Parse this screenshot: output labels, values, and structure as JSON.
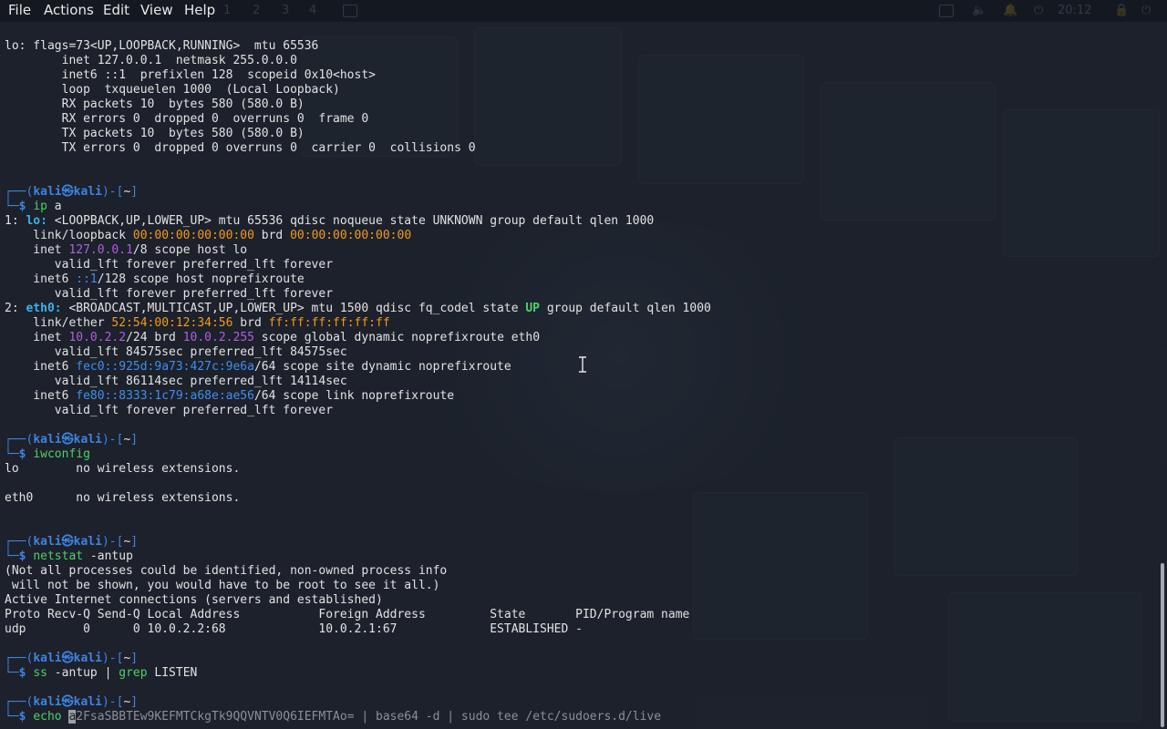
{
  "menubar": {
    "items": [
      {
        "id": "file",
        "label": "File"
      },
      {
        "id": "actions",
        "label": "Actions"
      },
      {
        "id": "edit",
        "label": "Edit"
      },
      {
        "id": "view",
        "label": "View"
      },
      {
        "id": "help",
        "label": "Help"
      }
    ],
    "workspaces": [
      "1",
      "2",
      "3",
      "4"
    ],
    "clock": "20:12"
  },
  "colors": {
    "prompt": "#3f83e0",
    "interface": "#3fb0e8",
    "mac": "#f59a1a",
    "ipv4": "#b25fdd",
    "ipv6": "#3f8ff0",
    "state_up": "#4ed36b",
    "command": "#4fcf6a"
  },
  "prompt": {
    "user": "kali",
    "at_icon": "skull-icon",
    "host": "kali",
    "dir": "~",
    "dollar": "$"
  },
  "lo_ifconfig": [
    "lo: flags=73<UP,LOOPBACK,RUNNING>  mtu 65536",
    "        inet 127.0.0.1  netmask 255.0.0.0",
    "        inet6 ::1  prefixlen 128  scopeid 0x10<host>",
    "        loop  txqueuelen 1000  (Local Loopback)",
    "        RX packets 10  bytes 580 (580.0 B)",
    "        RX errors 0  dropped 0  overruns 0  frame 0",
    "        TX packets 10  bytes 580 (580.0 B)",
    "        TX errors 0  dropped 0 overruns 0  carrier 0  collisions 0"
  ],
  "cmd_ip": {
    "command": "ip",
    "args": " a"
  },
  "ip_a": {
    "l1_num": "1: ",
    "l1_if": "lo:",
    "l1_rest": " <LOOPBACK,UP,LOWER_UP> mtu 65536 qdisc noqueue state UNKNOWN group default qlen 1000",
    "l2_pre": "    link/loopback ",
    "l2_mac": "00:00:00:00:00:00",
    "l2_mid": " brd ",
    "l2_brd": "00:00:00:00:00:00",
    "l3_pre": "    inet ",
    "l3_ip": "127.0.0.1",
    "l3_post": "/8 scope host lo",
    "l4": "       valid_lft forever preferred_lft forever",
    "l5_pre": "    inet6 ",
    "l5_ip": "::1",
    "l5_post": "/128 scope host noprefixroute",
    "l6": "       valid_lft forever preferred_lft forever",
    "l7_num": "2: ",
    "l7_if": "eth0:",
    "l7_mid": " <BROADCAST,MULTICAST,UP,LOWER_UP> mtu 1500 qdisc fq_codel state ",
    "l7_state": "UP",
    "l7_post": " group default qlen 1000",
    "l8_pre": "    link/ether ",
    "l8_mac": "52:54:00:12:34:56",
    "l8_mid": " brd ",
    "l8_brd": "ff:ff:ff:ff:ff:ff",
    "l9_pre": "    inet ",
    "l9_ip": "10.0.2.2",
    "l9_mid": "/24 brd ",
    "l9_brd": "10.0.2.255",
    "l9_post": " scope global dynamic noprefixroute eth0",
    "l10": "       valid_lft 84575sec preferred_lft 84575sec",
    "l11_pre": "    inet6 ",
    "l11_ip": "fec0::925d:9a73:427c:9e6a",
    "l11_post": "/64 scope site dynamic noprefixroute",
    "l12": "       valid_lft 86114sec preferred_lft 14114sec",
    "l13_pre": "    inet6 ",
    "l13_ip": "fe80::8333:1c79:a68e:ae56",
    "l13_post": "/64 scope link noprefixroute",
    "l14": "       valid_lft forever preferred_lft forever"
  },
  "cmd_iwconfig": {
    "command": "iwconfig"
  },
  "iwconfig": [
    "lo        no wireless extensions.",
    "eth0      no wireless extensions."
  ],
  "cmd_netstat": {
    "command": "netstat",
    "args": " -antup"
  },
  "netstat": [
    "(Not all processes could be identified, non-owned process info",
    " will not be shown, you would have to be root to see it all.)",
    "Active Internet connections (servers and established)",
    "Proto Recv-Q Send-Q Local Address           Foreign Address         State       PID/Program name",
    "udp        0      0 10.0.2.2:68             10.0.2.1:67             ESTABLISHED -"
  ],
  "cmd_ss": {
    "command": "ss",
    "args": " -antup | ",
    "pipe_cmd": "grep",
    "pipe_args": " LISTEN"
  },
  "current_input": {
    "command": "echo",
    "space": " ",
    "cursor_char": "a",
    "rest": "2FsaSBBTEw9KEFMTCkgTk9QQVNTV0Q6IEFMTAo= | base64 -d | sudo tee /etc/sudoers.d/live"
  }
}
